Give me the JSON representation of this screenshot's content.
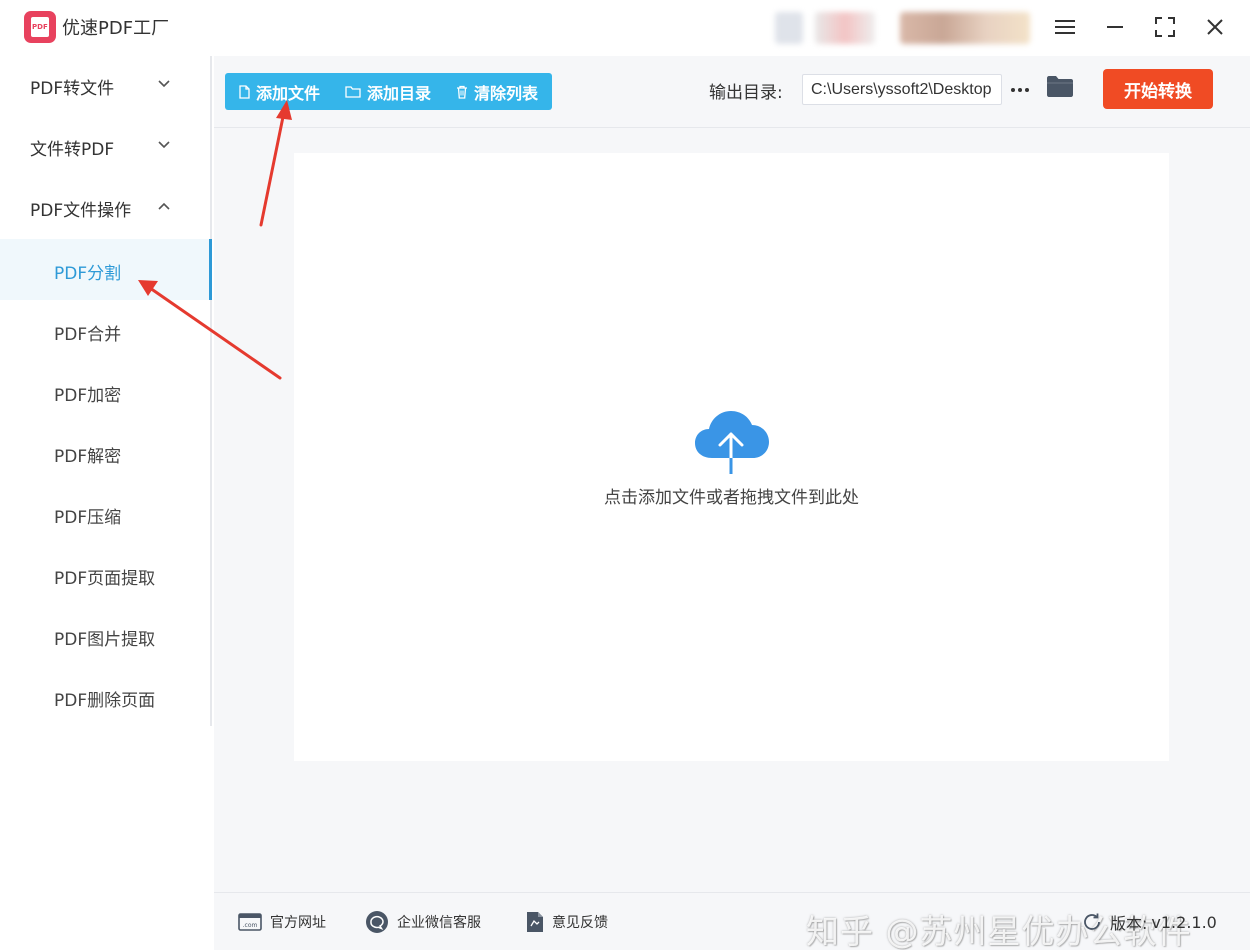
{
  "app": {
    "title": "优速PDF工厂",
    "logo_text": "PDF"
  },
  "window": {
    "menu_icon": "hamburger-icon",
    "minimize_icon": "minimize-icon",
    "maximize_icon": "maximize-icon",
    "close_icon": "close-icon"
  },
  "sidebar": {
    "groups": [
      {
        "label": "PDF转文件",
        "expanded": false
      },
      {
        "label": "文件转PDF",
        "expanded": false
      },
      {
        "label": "PDF文件操作",
        "expanded": true
      }
    ],
    "items": [
      {
        "label": "PDF分割",
        "active": true
      },
      {
        "label": "PDF合并"
      },
      {
        "label": "PDF加密"
      },
      {
        "label": "PDF解密"
      },
      {
        "label": "PDF压缩"
      },
      {
        "label": "PDF页面提取"
      },
      {
        "label": "PDF图片提取"
      },
      {
        "label": "PDF删除页面"
      }
    ]
  },
  "toolbar": {
    "add_file": "添加文件",
    "add_dir": "添加目录",
    "clear_list": "清除列表",
    "output_label": "输出目录:",
    "output_path": "C:\\Users\\yssoft2\\Desktop",
    "more_label": "···",
    "start": "开始转换"
  },
  "dropzone": {
    "text": "点击添加文件或者拖拽文件到此处",
    "icon": "cloud-upload-icon"
  },
  "footer": {
    "website": "官方网址",
    "wechat": "企业微信客服",
    "feedback": "意见反馈",
    "watermark": "知乎 @苏州星优办公软件",
    "version_label": "版本:",
    "version": "v1.2.1.0"
  },
  "colors": {
    "accent": "#35b5ea",
    "active_text": "#2e9ad7",
    "start_button": "#f04b24",
    "annotation_arrow": "#e53a2f"
  }
}
